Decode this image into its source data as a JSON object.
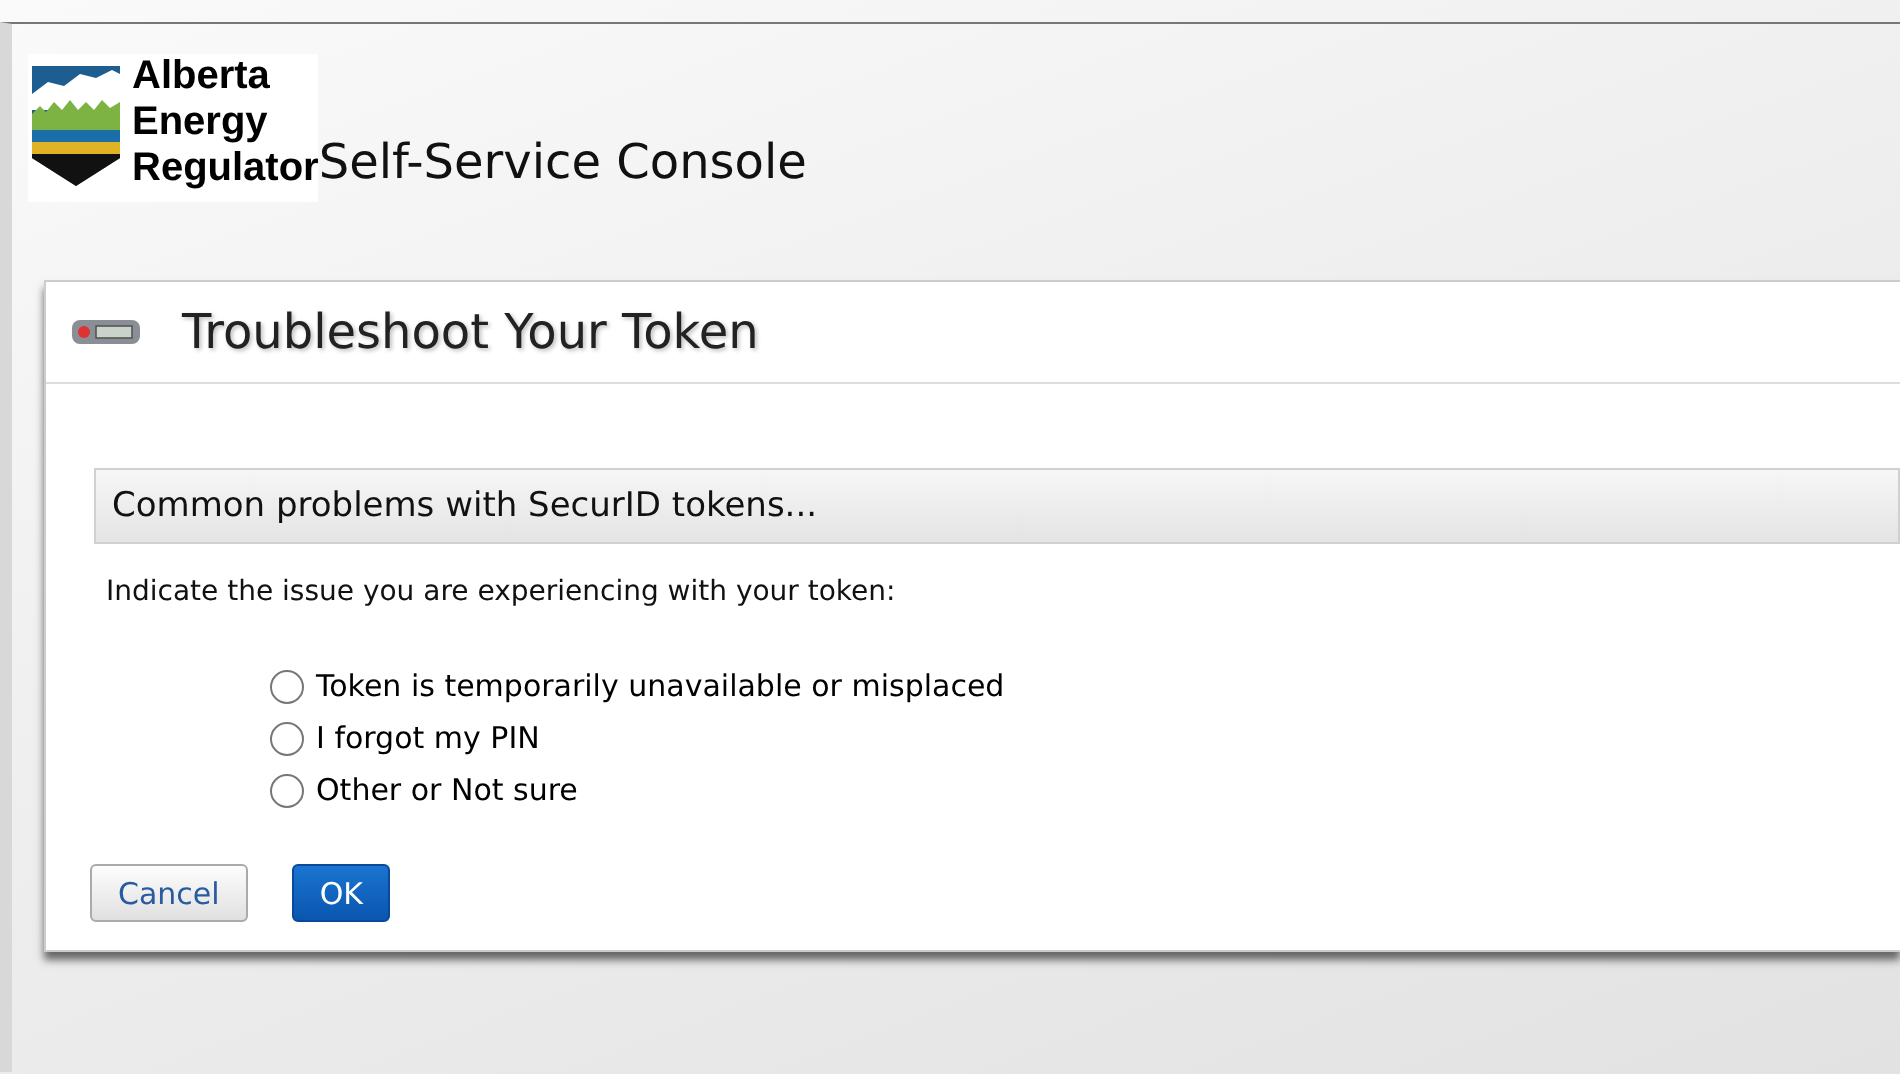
{
  "header": {
    "logo_lines": [
      "Alberta",
      "Energy",
      "Regulator"
    ],
    "title": "Self-Service Console"
  },
  "panel": {
    "title": "Troubleshoot Your Token",
    "section_title": "Common problems with SecurID tokens...",
    "prompt": "Indicate the issue you are experiencing with your token:",
    "options": [
      {
        "label": "Token is temporarily unavailable or misplaced",
        "selected": false
      },
      {
        "label": "I forgot my PIN",
        "selected": false
      },
      {
        "label": "Other or Not sure",
        "selected": false
      }
    ],
    "buttons": [
      {
        "label": "Cancel",
        "kind": "secondary"
      },
      {
        "label": "OK",
        "kind": "primary"
      }
    ]
  }
}
